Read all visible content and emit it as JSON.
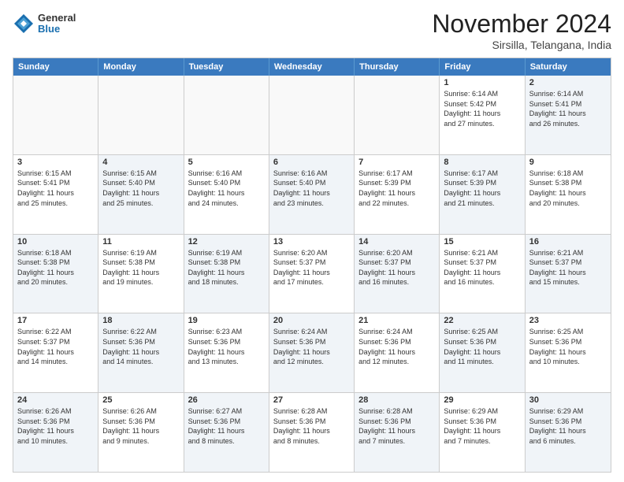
{
  "header": {
    "logo_general": "General",
    "logo_blue": "Blue",
    "month_title": "November 2024",
    "location": "Sirsilla, Telangana, India"
  },
  "calendar": {
    "days_of_week": [
      "Sunday",
      "Monday",
      "Tuesday",
      "Wednesday",
      "Thursday",
      "Friday",
      "Saturday"
    ],
    "rows": [
      [
        {
          "day": "",
          "empty": true
        },
        {
          "day": "",
          "empty": true
        },
        {
          "day": "",
          "empty": true
        },
        {
          "day": "",
          "empty": true
        },
        {
          "day": "",
          "empty": true
        },
        {
          "day": "1",
          "lines": [
            "Sunrise: 6:14 AM",
            "Sunset: 5:42 PM",
            "Daylight: 11 hours",
            "and 27 minutes."
          ]
        },
        {
          "day": "2",
          "lines": [
            "Sunrise: 6:14 AM",
            "Sunset: 5:41 PM",
            "Daylight: 11 hours",
            "and 26 minutes."
          ],
          "shaded": true
        }
      ],
      [
        {
          "day": "3",
          "lines": [
            "Sunrise: 6:15 AM",
            "Sunset: 5:41 PM",
            "Daylight: 11 hours",
            "and 25 minutes."
          ]
        },
        {
          "day": "4",
          "lines": [
            "Sunrise: 6:15 AM",
            "Sunset: 5:40 PM",
            "Daylight: 11 hours",
            "and 25 minutes."
          ],
          "shaded": true
        },
        {
          "day": "5",
          "lines": [
            "Sunrise: 6:16 AM",
            "Sunset: 5:40 PM",
            "Daylight: 11 hours",
            "and 24 minutes."
          ]
        },
        {
          "day": "6",
          "lines": [
            "Sunrise: 6:16 AM",
            "Sunset: 5:40 PM",
            "Daylight: 11 hours",
            "and 23 minutes."
          ],
          "shaded": true
        },
        {
          "day": "7",
          "lines": [
            "Sunrise: 6:17 AM",
            "Sunset: 5:39 PM",
            "Daylight: 11 hours",
            "and 22 minutes."
          ]
        },
        {
          "day": "8",
          "lines": [
            "Sunrise: 6:17 AM",
            "Sunset: 5:39 PM",
            "Daylight: 11 hours",
            "and 21 minutes."
          ],
          "shaded": true
        },
        {
          "day": "9",
          "lines": [
            "Sunrise: 6:18 AM",
            "Sunset: 5:38 PM",
            "Daylight: 11 hours",
            "and 20 minutes."
          ]
        }
      ],
      [
        {
          "day": "10",
          "lines": [
            "Sunrise: 6:18 AM",
            "Sunset: 5:38 PM",
            "Daylight: 11 hours",
            "and 20 minutes."
          ],
          "shaded": true
        },
        {
          "day": "11",
          "lines": [
            "Sunrise: 6:19 AM",
            "Sunset: 5:38 PM",
            "Daylight: 11 hours",
            "and 19 minutes."
          ]
        },
        {
          "day": "12",
          "lines": [
            "Sunrise: 6:19 AM",
            "Sunset: 5:38 PM",
            "Daylight: 11 hours",
            "and 18 minutes."
          ],
          "shaded": true
        },
        {
          "day": "13",
          "lines": [
            "Sunrise: 6:20 AM",
            "Sunset: 5:37 PM",
            "Daylight: 11 hours",
            "and 17 minutes."
          ]
        },
        {
          "day": "14",
          "lines": [
            "Sunrise: 6:20 AM",
            "Sunset: 5:37 PM",
            "Daylight: 11 hours",
            "and 16 minutes."
          ],
          "shaded": true
        },
        {
          "day": "15",
          "lines": [
            "Sunrise: 6:21 AM",
            "Sunset: 5:37 PM",
            "Daylight: 11 hours",
            "and 16 minutes."
          ]
        },
        {
          "day": "16",
          "lines": [
            "Sunrise: 6:21 AM",
            "Sunset: 5:37 PM",
            "Daylight: 11 hours",
            "and 15 minutes."
          ],
          "shaded": true
        }
      ],
      [
        {
          "day": "17",
          "lines": [
            "Sunrise: 6:22 AM",
            "Sunset: 5:37 PM",
            "Daylight: 11 hours",
            "and 14 minutes."
          ]
        },
        {
          "day": "18",
          "lines": [
            "Sunrise: 6:22 AM",
            "Sunset: 5:36 PM",
            "Daylight: 11 hours",
            "and 14 minutes."
          ],
          "shaded": true
        },
        {
          "day": "19",
          "lines": [
            "Sunrise: 6:23 AM",
            "Sunset: 5:36 PM",
            "Daylight: 11 hours",
            "and 13 minutes."
          ]
        },
        {
          "day": "20",
          "lines": [
            "Sunrise: 6:24 AM",
            "Sunset: 5:36 PM",
            "Daylight: 11 hours",
            "and 12 minutes."
          ],
          "shaded": true
        },
        {
          "day": "21",
          "lines": [
            "Sunrise: 6:24 AM",
            "Sunset: 5:36 PM",
            "Daylight: 11 hours",
            "and 12 minutes."
          ]
        },
        {
          "day": "22",
          "lines": [
            "Sunrise: 6:25 AM",
            "Sunset: 5:36 PM",
            "Daylight: 11 hours",
            "and 11 minutes."
          ],
          "shaded": true
        },
        {
          "day": "23",
          "lines": [
            "Sunrise: 6:25 AM",
            "Sunset: 5:36 PM",
            "Daylight: 11 hours",
            "and 10 minutes."
          ]
        }
      ],
      [
        {
          "day": "24",
          "lines": [
            "Sunrise: 6:26 AM",
            "Sunset: 5:36 PM",
            "Daylight: 11 hours",
            "and 10 minutes."
          ],
          "shaded": true
        },
        {
          "day": "25",
          "lines": [
            "Sunrise: 6:26 AM",
            "Sunset: 5:36 PM",
            "Daylight: 11 hours",
            "and 9 minutes."
          ]
        },
        {
          "day": "26",
          "lines": [
            "Sunrise: 6:27 AM",
            "Sunset: 5:36 PM",
            "Daylight: 11 hours",
            "and 8 minutes."
          ],
          "shaded": true
        },
        {
          "day": "27",
          "lines": [
            "Sunrise: 6:28 AM",
            "Sunset: 5:36 PM",
            "Daylight: 11 hours",
            "and 8 minutes."
          ]
        },
        {
          "day": "28",
          "lines": [
            "Sunrise: 6:28 AM",
            "Sunset: 5:36 PM",
            "Daylight: 11 hours",
            "and 7 minutes."
          ],
          "shaded": true
        },
        {
          "day": "29",
          "lines": [
            "Sunrise: 6:29 AM",
            "Sunset: 5:36 PM",
            "Daylight: 11 hours",
            "and 7 minutes."
          ]
        },
        {
          "day": "30",
          "lines": [
            "Sunrise: 6:29 AM",
            "Sunset: 5:36 PM",
            "Daylight: 11 hours",
            "and 6 minutes."
          ],
          "shaded": true
        }
      ]
    ]
  }
}
